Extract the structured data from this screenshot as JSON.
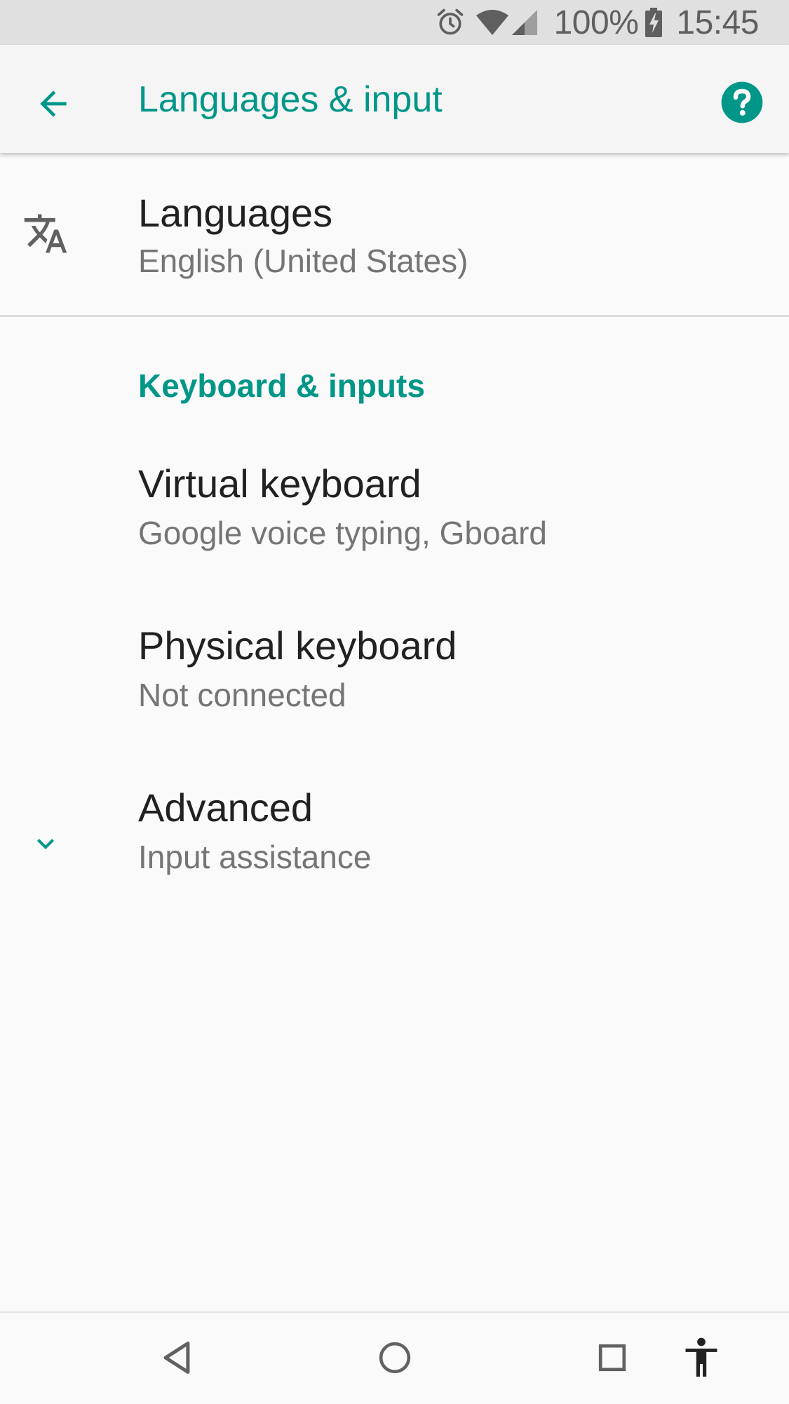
{
  "status_bar": {
    "battery": "100%",
    "time": "15:45",
    "icons": [
      "alarm-icon",
      "wifi-icon",
      "signal-icon",
      "battery-charging-icon"
    ]
  },
  "app_bar": {
    "title": "Languages & input",
    "back_icon": "arrow-back-icon",
    "help_icon": "help-icon"
  },
  "languages": {
    "title": "Languages",
    "subtitle": "English (United States)",
    "icon": "translate-icon"
  },
  "section": {
    "header": "Keyboard & inputs"
  },
  "items": [
    {
      "title": "Virtual keyboard",
      "subtitle": "Google voice typing, Gboard"
    },
    {
      "title": "Physical keyboard",
      "subtitle": "Not connected"
    }
  ],
  "advanced": {
    "title": "Advanced",
    "subtitle": "Input assistance",
    "icon": "chevron-down-icon"
  },
  "nav_bar": {
    "icons": [
      "back-nav-icon",
      "home-nav-icon",
      "recents-nav-icon",
      "accessibility-icon"
    ]
  },
  "colors": {
    "accent": "#009688",
    "primary_text": "#212121",
    "secondary_text": "#757575",
    "background": "#fafafa"
  }
}
